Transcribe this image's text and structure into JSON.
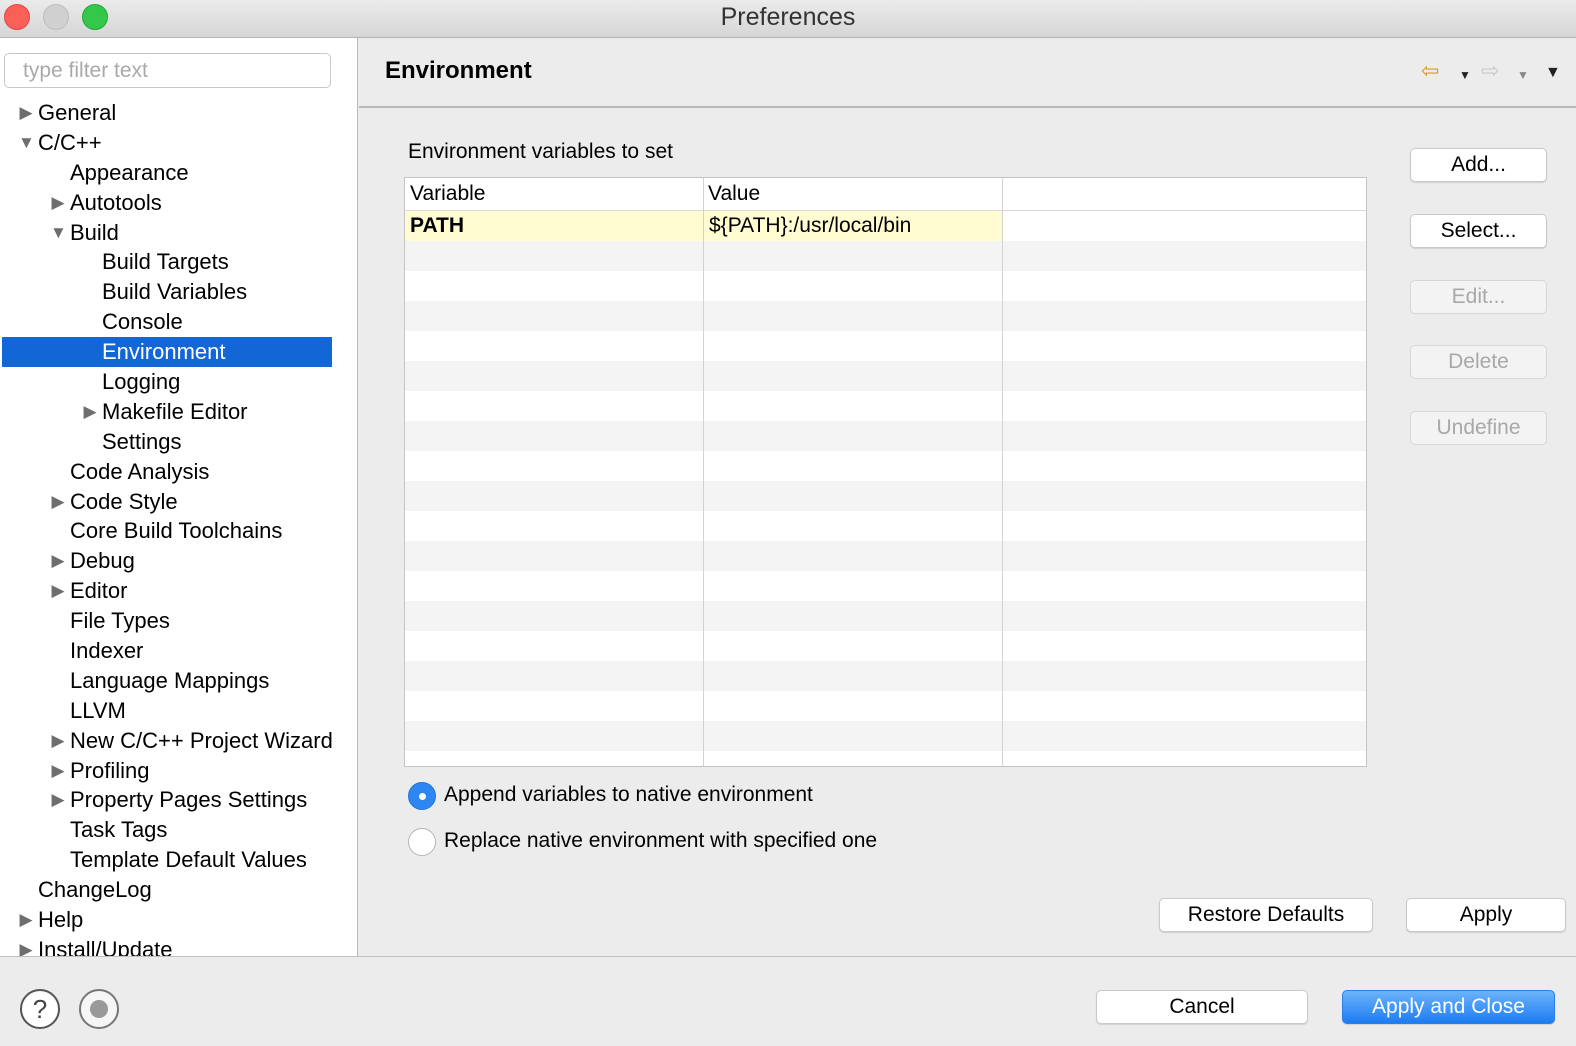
{
  "window": {
    "title": "Preferences"
  },
  "filter": {
    "placeholder": "type filter text",
    "value": ""
  },
  "tree": [
    {
      "label": "General",
      "level": 0,
      "expander": "collapsed"
    },
    {
      "label": "C/C++",
      "level": 0,
      "expander": "expanded"
    },
    {
      "label": "Appearance",
      "level": 1,
      "expander": "none"
    },
    {
      "label": "Autotools",
      "level": 1,
      "expander": "collapsed"
    },
    {
      "label": "Build",
      "level": 1,
      "expander": "expanded"
    },
    {
      "label": "Build Targets",
      "level": 2,
      "expander": "none"
    },
    {
      "label": "Build Variables",
      "level": 2,
      "expander": "none"
    },
    {
      "label": "Console",
      "level": 2,
      "expander": "none"
    },
    {
      "label": "Environment",
      "level": 2,
      "expander": "none",
      "selected": true
    },
    {
      "label": "Logging",
      "level": 2,
      "expander": "none"
    },
    {
      "label": "Makefile Editor",
      "level": 2,
      "expander": "collapsed"
    },
    {
      "label": "Settings",
      "level": 2,
      "expander": "none"
    },
    {
      "label": "Code Analysis",
      "level": 1,
      "expander": "none"
    },
    {
      "label": "Code Style",
      "level": 1,
      "expander": "collapsed"
    },
    {
      "label": "Core Build Toolchains",
      "level": 1,
      "expander": "none"
    },
    {
      "label": "Debug",
      "level": 1,
      "expander": "collapsed"
    },
    {
      "label": "Editor",
      "level": 1,
      "expander": "collapsed"
    },
    {
      "label": "File Types",
      "level": 1,
      "expander": "none"
    },
    {
      "label": "Indexer",
      "level": 1,
      "expander": "none"
    },
    {
      "label": "Language Mappings",
      "level": 1,
      "expander": "none"
    },
    {
      "label": "LLVM",
      "level": 1,
      "expander": "none"
    },
    {
      "label": "New C/C++ Project Wizard",
      "level": 1,
      "expander": "collapsed"
    },
    {
      "label": "Profiling",
      "level": 1,
      "expander": "collapsed"
    },
    {
      "label": "Property Pages Settings",
      "level": 1,
      "expander": "collapsed"
    },
    {
      "label": "Task Tags",
      "level": 1,
      "expander": "none"
    },
    {
      "label": "Template Default Values",
      "level": 1,
      "expander": "none"
    },
    {
      "label": "ChangeLog",
      "level": 0,
      "expander": "none"
    },
    {
      "label": "Help",
      "level": 0,
      "expander": "collapsed"
    },
    {
      "label": "Install/Update",
      "level": 0,
      "expander": "collapsed"
    }
  ],
  "page": {
    "title": "Environment",
    "nav": {
      "back_icon": "arrow-left-icon",
      "forward_icon": "arrow-right-icon",
      "menu_icon": "triangle-down-icon"
    },
    "section_label": "Environment variables to set",
    "table": {
      "columns": [
        "Variable",
        "Value"
      ],
      "rows": [
        {
          "variable": "PATH",
          "value": "${PATH}:/usr/local/bin"
        }
      ]
    },
    "buttons": {
      "add": "Add...",
      "select": "Select...",
      "edit": "Edit...",
      "delete": "Delete",
      "undefine": "Undefine"
    },
    "radios": {
      "append": "Append variables to native environment",
      "replace": "Replace native environment with specified one",
      "selected": "append"
    },
    "restore_defaults": "Restore Defaults",
    "apply": "Apply"
  },
  "footer": {
    "help_icon": "help-icon",
    "record_icon": "record-icon",
    "cancel": "Cancel",
    "apply_and_close": "Apply and Close"
  },
  "colors": {
    "selection": "#1366d6",
    "highlight_cell": "#fffcd1",
    "primary_button": "#1d7cf2"
  }
}
